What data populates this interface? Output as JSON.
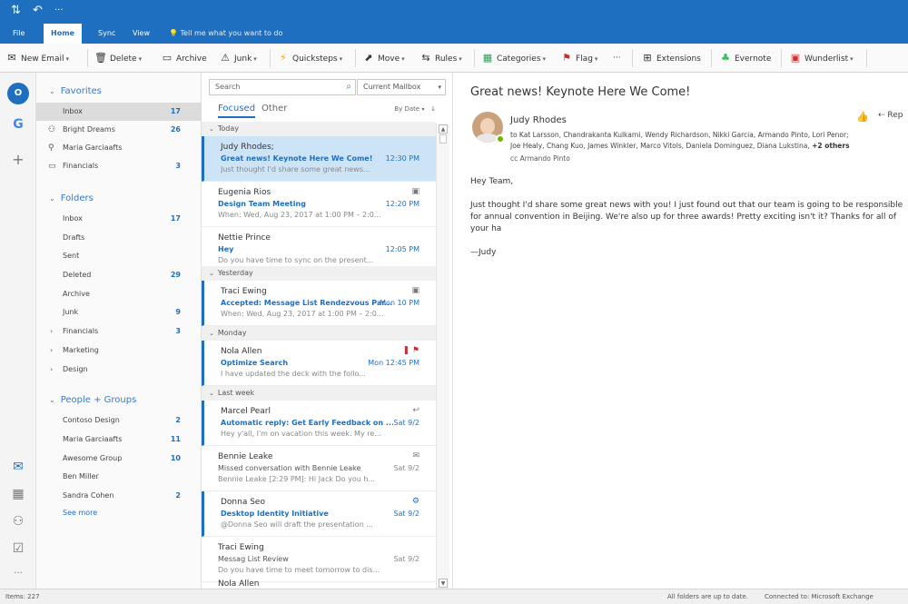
{
  "ribbon_tabs": [
    "File",
    "Home",
    "Sync",
    "View"
  ],
  "tell_me": "Tell me what you want to do",
  "ribbon": {
    "new_email": "New Email",
    "delete": "Delete",
    "archive": "Archive",
    "junk": "Junk",
    "quicksteps": "Quicksteps",
    "move": "Move",
    "rules": "Rules",
    "categories": "Categories",
    "flag": "Flag",
    "more": "···",
    "extensions": "Extensions",
    "evernote": "Evernote",
    "wunderlist": "Wunderlist"
  },
  "folders": {
    "favorites_title": "Favorites",
    "favorites": [
      {
        "label": "Inbox",
        "count": "17"
      },
      {
        "label": "Bright Dreams",
        "count": "26"
      },
      {
        "label": "Maria Garciaafts",
        "count": ""
      },
      {
        "label": "Financials",
        "count": "3"
      }
    ],
    "folders_title": "Folders",
    "folders": [
      {
        "label": "Inbox",
        "count": "17"
      },
      {
        "label": "Drafts",
        "count": ""
      },
      {
        "label": "Sent",
        "count": ""
      },
      {
        "label": "Deleted",
        "count": "29"
      },
      {
        "label": "Archive",
        "count": ""
      },
      {
        "label": "Junk",
        "count": "9"
      },
      {
        "label": "Financials",
        "count": "3"
      },
      {
        "label": "Marketing",
        "count": ""
      },
      {
        "label": "Design",
        "count": ""
      }
    ],
    "groups_title": "People + Groups",
    "groups": [
      {
        "label": "Contoso Design",
        "count": "2"
      },
      {
        "label": "Maria Garciaafts",
        "count": "11"
      },
      {
        "label": "Awesome Group",
        "count": "10"
      },
      {
        "label": "Ben Miller",
        "count": ""
      },
      {
        "label": "Sandra Cohen",
        "count": "2"
      }
    ],
    "see_more": "See more"
  },
  "list": {
    "search_placeholder": "Search",
    "scope": "Current Mailbox",
    "tab_focused": "Focused",
    "tab_other": "Other",
    "sort": "By Date",
    "groups": {
      "today": "Today",
      "yesterday": "Yesterday",
      "monday": "Monday",
      "lastweek": "Last week"
    },
    "messages": [
      {
        "from": "Judy Rhodes;",
        "subject": "Great news! Keynote Here We Come!",
        "time": "12:30 PM",
        "preview": "Just thought I'd share some great news..."
      },
      {
        "from": "Eugenia Rios",
        "subject": "Design Team Meeting",
        "time": "12:20 PM",
        "preview": "When: Wed, Aug 23, 2017 at 1:00 PM – 2:0..."
      },
      {
        "from": "Nettie Prince",
        "subject": "Hey",
        "time": "12:05 PM",
        "preview": "Do you have time to sync on the present..."
      },
      {
        "from": "Traci Ewing",
        "subject": "Accepted: Message List Rendezvous Par...",
        "time": "Mon 10 PM",
        "preview": "When: Wed, Aug 23, 2017 at 1:00 PM – 2:0..."
      },
      {
        "from": "Nola Allen",
        "subject": "Optimize Search",
        "time": "Mon 12:45 PM",
        "preview": "I have updated the deck with the follo..."
      },
      {
        "from": "Marcel Pearl",
        "subject": "Automatic reply: Get Early Feedback on ...",
        "time": "Sat 9/2",
        "preview": "Hey y'all, I'm on vacation this week. My re..."
      },
      {
        "from": "Bennie Leake",
        "subject": "Missed conversation with Bennie Leake",
        "time": "Sat 9/2",
        "preview": "Bennie Leake [2:29 PM]: Hi Jack Do you h..."
      },
      {
        "from": "Donna Seo",
        "subject": "Desktop Identity Initiative",
        "time": "Sat 9/2",
        "preview": "@Donna Seo will draft the presentation ..."
      },
      {
        "from": "Traci Ewing",
        "subject": "Messag List Review",
        "time": "Sat 9/2",
        "preview": "Do you have time to meet tomorrow to dis..."
      },
      {
        "from": "Nola Allen",
        "subject": "",
        "time": "",
        "preview": ""
      }
    ]
  },
  "reading": {
    "subject": "Great news! Keynote Here We Come!",
    "sender": "Judy Rhodes",
    "to_line": "to Kat Larsson, Chandrakanta Kulkarni, Wendy Richardson, Nikki Garcia, Armando Pinto, Lori Penor;",
    "to_line2": "Joe Healy, Chang Kuo, James Winkler, Marco Vitols, Daniela Dominguez, Diana Lukstina, ",
    "more": "+2 others",
    "cc": "cc Armando Pinto",
    "reply": "Rep",
    "greeting": "Hey Team,",
    "para": "Just thought I'd share some great news with you! I just found out that our team is going to be responsible for annual convention in Beijing. We're also up for three awards! Pretty exciting isn't it? Thanks for all of your ha",
    "sign": "—Judy"
  },
  "status": {
    "items": "Items: 227",
    "sync": "All folders are up to date.",
    "conn": "Connected to: Microsoft Exchange"
  },
  "colors": {
    "accent": "#1e6fc0",
    "selected": "#cde4f7"
  }
}
